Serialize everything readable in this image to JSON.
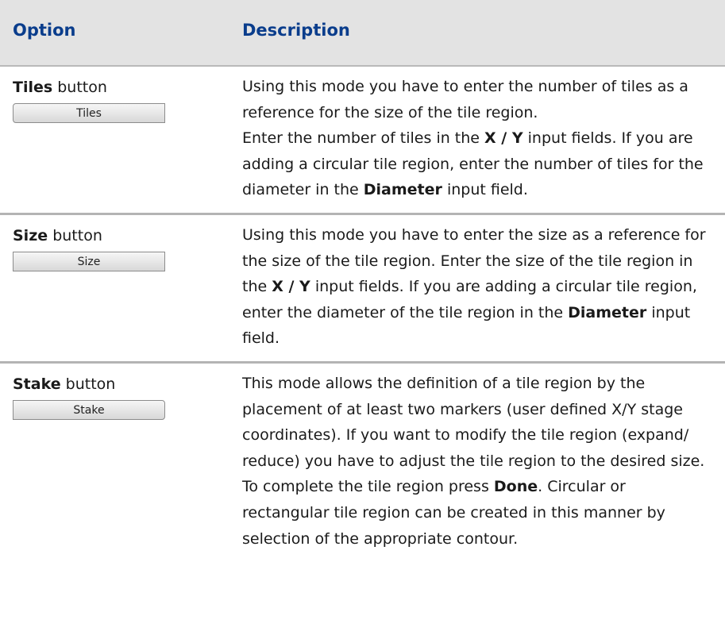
{
  "header": {
    "option": "Option",
    "description": "Description"
  },
  "rows": [
    {
      "option_name": "Tiles",
      "option_suffix": " button",
      "button_label": "Tiles",
      "desc": [
        "Using this mode you have to enter the number of tiles as a reference for the size of the tile region.",
        "Enter the number of tiles in the ",
        "X / Y",
        " input fields. If you are adding a circular tile region, enter the number of tiles for the diameter in the ",
        "Diameter",
        " input field."
      ]
    },
    {
      "option_name": "Size",
      "option_suffix": " button",
      "button_label": "Size",
      "desc": [
        "Using this mode you have to enter the size as a reference for the size of the tile region. Enter the size of the tile region in the ",
        "X / Y",
        " input fields. If you are adding a circular tile region, enter the diameter of the tile region in the ",
        "Diameter",
        " input field."
      ]
    },
    {
      "option_name": "Stake",
      "option_suffix": " button",
      "button_label": "Stake",
      "desc": [
        "This mode allows the definition of a tile region by the placement of at least two markers (user defined X/Y stage coordinates). If you want to modify the tile region (expand/ reduce) you have to adjust the tile region to the desired size. To complete the tile region press ",
        "Done",
        ". Circular or rectangular tile region can be created in this manner by selection of the appropriate contour."
      ]
    }
  ]
}
